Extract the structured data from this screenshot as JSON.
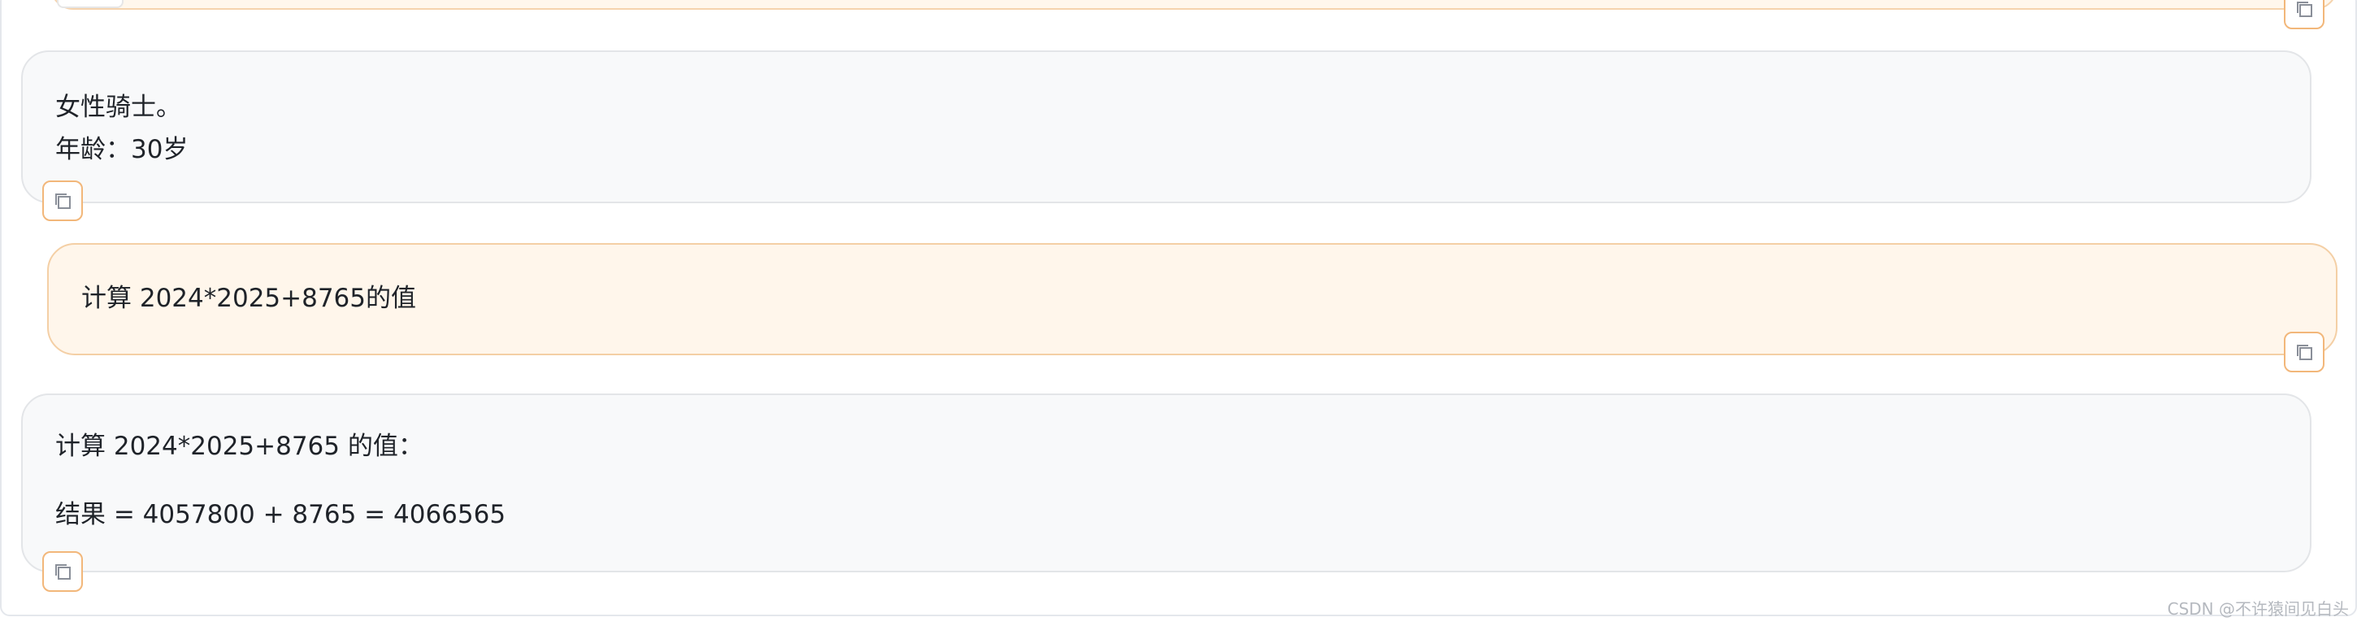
{
  "messages": [
    {
      "role": "bot",
      "lines": [
        "女性骑士。",
        "年龄：30岁"
      ]
    },
    {
      "role": "user",
      "lines": [
        "计算 2024*2025+8765的值"
      ]
    },
    {
      "role": "bot",
      "lines": [
        "计算 2024*2025+8765 的值：",
        "",
        "结果 = 4057800 + 8765 = 4066565"
      ]
    }
  ],
  "icons": {
    "copy": "copy-icon"
  },
  "colors": {
    "bot_bubble_bg": "#f8f9fa",
    "user_bubble_bg": "#fff6eb",
    "user_bubble_border": "#f4cfa5",
    "copy_button_border": "#f2b77a"
  },
  "watermark": "CSDN @不许猿间见白头"
}
